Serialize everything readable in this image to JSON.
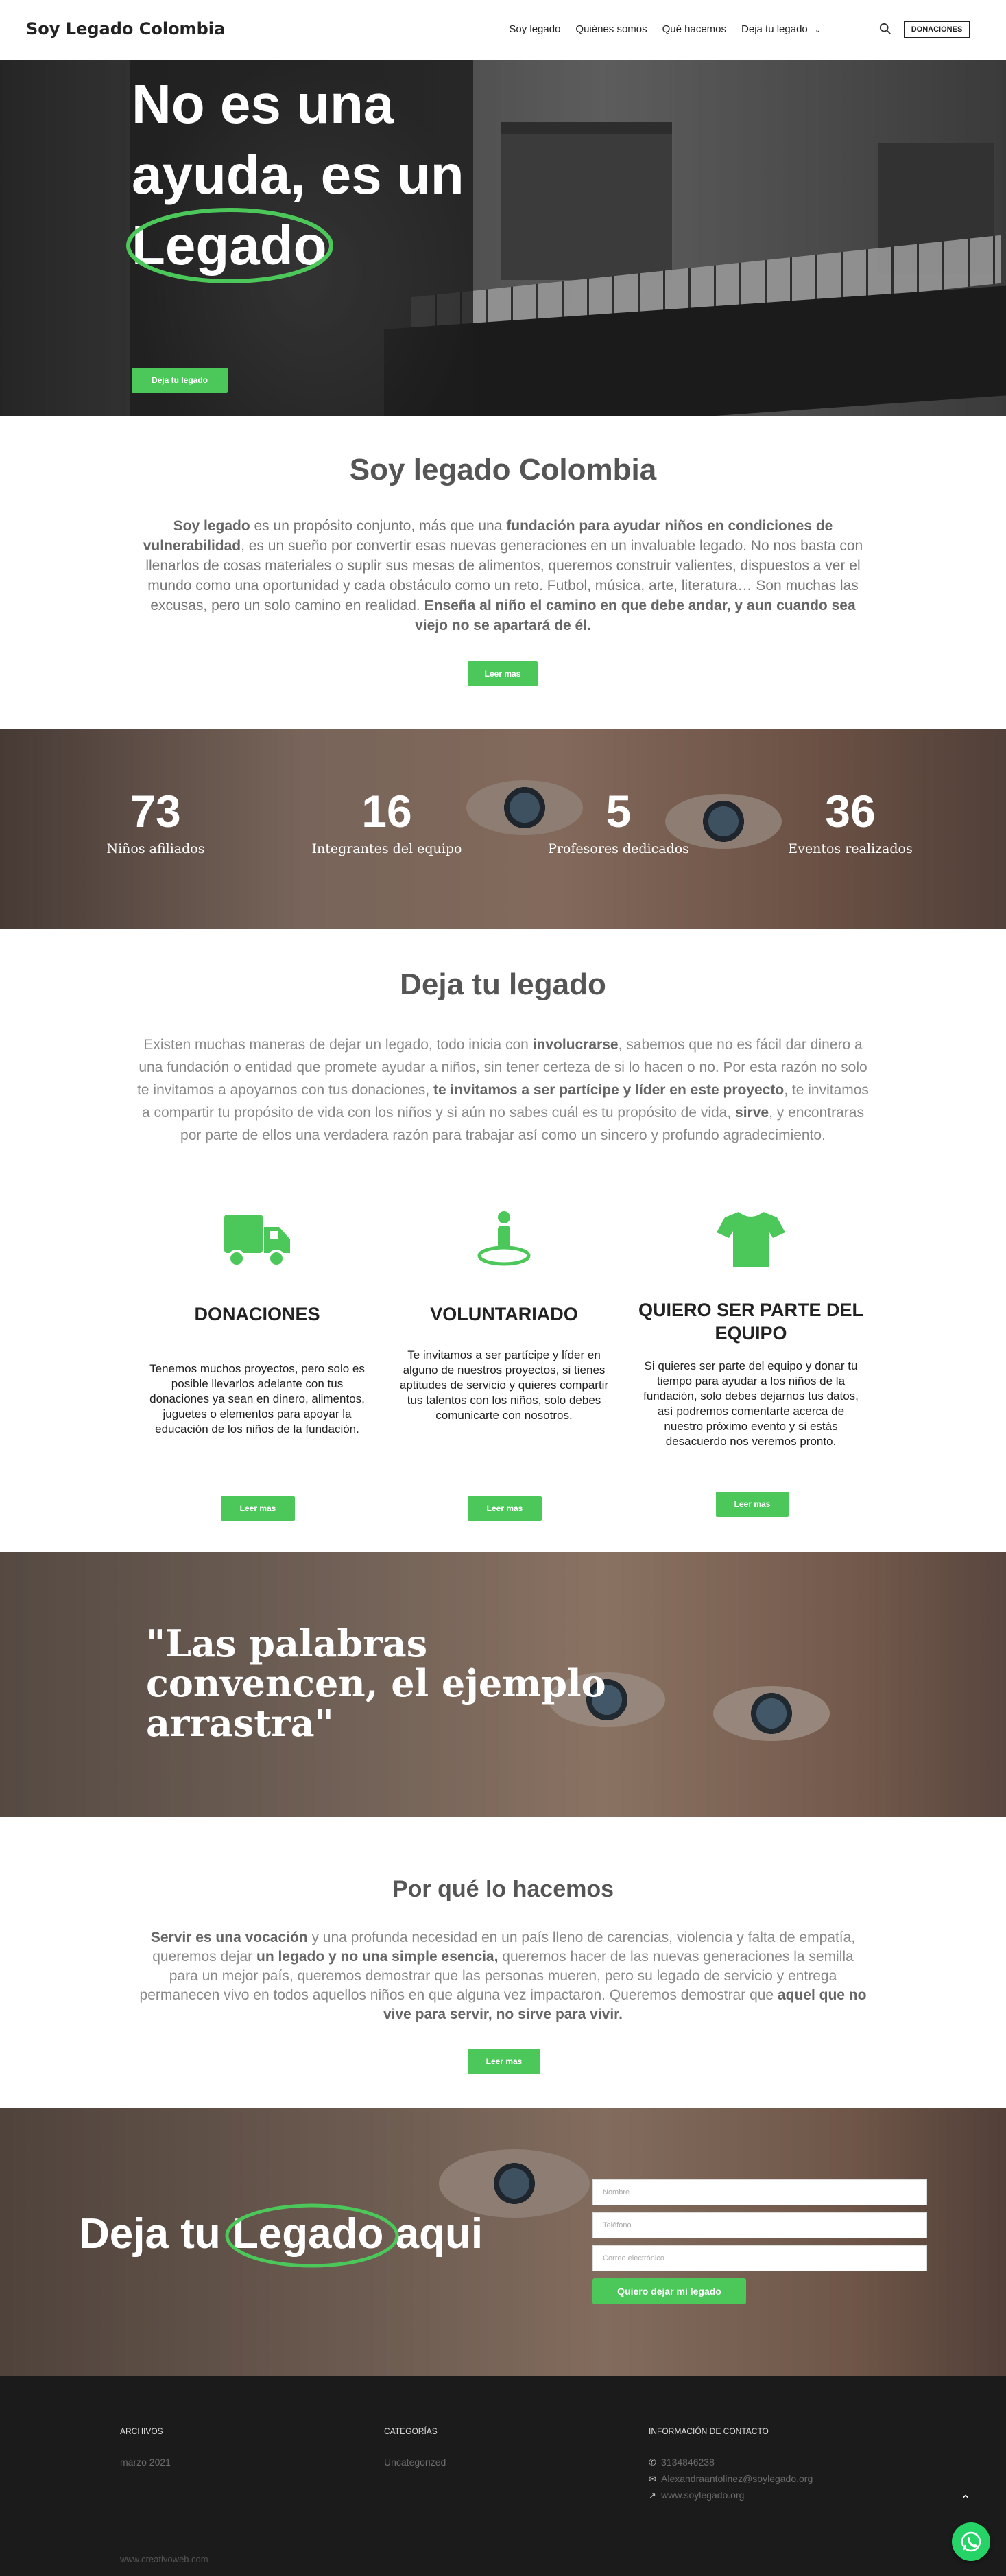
{
  "header": {
    "logo": "Soy Legado Colombia",
    "nav": [
      "Soy legado",
      "Quiénes somos",
      "Qué hacemos",
      "Deja tu legado"
    ],
    "donate": "DONACIONES"
  },
  "hero": {
    "line1": "No es una",
    "line2": "ayuda, es un",
    "line3": "Legado",
    "button": "Deja tu legado"
  },
  "about": {
    "title": "Soy legado Colombia",
    "p1_b1": "Soy legado",
    "p1_t1": " es un propósito conjunto, más que una ",
    "p1_b2": "fundación para ayudar niños en condiciones de vulnerabilidad",
    "p1_t2": ", es un sueño por convertir esas nuevas generaciones en un invaluable legado. No nos basta con llenarlos de cosas materiales o suplir sus mesas de alimentos, queremos construir valientes, dispuestos a ver el mundo como una oportunidad y cada obstáculo como un reto.   Futbol, música, arte, literatura… Son muchas las excusas, pero un solo camino en realidad.  ",
    "p1_b3": "Enseña al niño el camino en que debe andar, y aun cuando sea viejo no se apartará de él.",
    "button": "Leer mas"
  },
  "stats": [
    {
      "num": "73",
      "label": "Niños afiliados"
    },
    {
      "num": "16",
      "label": "Integrantes del equipo"
    },
    {
      "num": "5",
      "label": "Profesores dedicados"
    },
    {
      "num": "36",
      "label": "Eventos realizados"
    }
  ],
  "deja": {
    "title": "Deja tu legado",
    "t1": "Existen muchas maneras de dejar un legado, todo inicia con ",
    "b1": "involucrarse",
    "t2": ", sabemos que no es fácil dar dinero a una fundación o entidad que promete ayudar a niños, sin tener certeza de si lo hacen o no.  Por esta razón no solo te invitamos a apoyarnos con tus donaciones, ",
    "b2": "te invitamos a ser partícipe y líder en este proyecto",
    "t3": ", te invitamos a compartir tu propósito de vida con los niños y si aún no sabes cuál es tu propósito de vida, ",
    "b3": "sirve",
    "t4": ", y encontraras por parte de ellos una verdadera razón para trabajar así como un sincero y profundo agradecimiento."
  },
  "cards": [
    {
      "title": "DONACIONES",
      "text": "Tenemos muchos proyectos, pero solo es posible llevarlos adelante con tus donaciones ya sean en dinero, alimentos, juguetes o elementos para apoyar la educación de los niños de la fundación.",
      "button": "Leer mas",
      "icon": "truck-icon"
    },
    {
      "title": "VOLUNTARIADO",
      "text": "Te invitamos a ser partícipe y líder en alguno de nuestros proyectos, si tienes aptitudes de servicio y quieres compartir tus talentos con los niños, solo debes comunicarte con nosotros.",
      "button": "Leer mas",
      "icon": "person-icon"
    },
    {
      "title": "QUIERO SER PARTE DEL EQUIPO",
      "text": "Si quieres ser parte del equipo y donar tu tiempo para ayudar a los niños de la fundación, solo debes dejarnos tus datos, así podremos comentarte acerca de nuestro próximo evento y si estás desacuerdo nos veremos pronto.",
      "button": "Leer mas",
      "icon": "tshirt-icon"
    }
  ],
  "quote": "\"Las palabras convencen, el ejemplo arrastra\"",
  "porque": {
    "title": "Por qué lo hacemos",
    "b1": "Servir es una vocación",
    "t1": " y una profunda necesidad en un país lleno de carencias, violencia y falta de empatía, queremos dejar ",
    "b2": "un legado y no una simple esencia,",
    "t2": " queremos hacer de las nuevas generaciones la semilla para un mejor país, queremos demostrar que las personas mueren, pero su legado de servicio y entrega permanecen vivo en todos aquellos niños en que alguna vez impactaron. Queremos demostrar que ",
    "b3": "aquel que no vive para servir, no sirve para vivir.",
    "button": "Leer mas"
  },
  "cta": {
    "pre": "Deja tu ",
    "word": "Legado",
    "post": " aqui",
    "placeholders": [
      "Nombre",
      "Teléfono",
      "Correo electrónico"
    ],
    "button": "Quiero dejar mi legado"
  },
  "footer": {
    "col1_title": "ARCHIVOS",
    "col1_item": "marzo 2021",
    "col2_title": "CATEGORÍAS",
    "col2_item": "Uncategorized",
    "col3_title": "INFORMACIÓN DE CONTACTO",
    "phone": "3134846238",
    "email": "Alexandraantolinez@soylegado.org",
    "web": "www.soylegado.org",
    "credit": "www.creativoweb.com"
  },
  "colors": {
    "accent": "#4cc75a",
    "footer": "#1b1b1b"
  }
}
